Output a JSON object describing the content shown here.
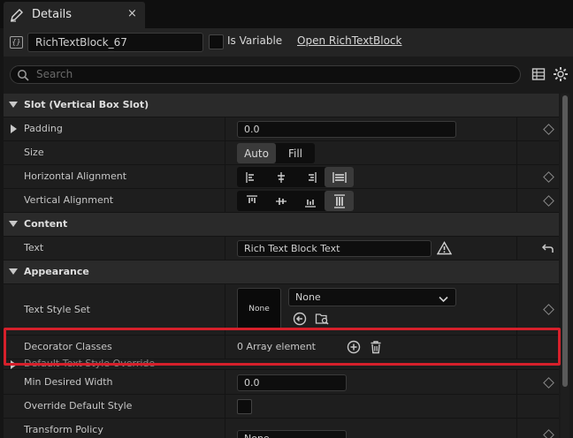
{
  "tab": {
    "title": "Details",
    "close": "×"
  },
  "header": {
    "widget_name": "RichTextBlock_67",
    "is_variable_label": "Is Variable",
    "open_link": "Open RichTextBlock"
  },
  "search": {
    "placeholder": "Search"
  },
  "sections": {
    "slot": "Slot (Vertical Box Slot)",
    "content": "Content",
    "appearance": "Appearance"
  },
  "props": {
    "padding": {
      "label": "Padding",
      "value": "0.0"
    },
    "size": {
      "label": "Size",
      "options": [
        "Auto",
        "Fill"
      ],
      "selected": "Auto"
    },
    "h_align": {
      "label": "Horizontal Alignment"
    },
    "v_align": {
      "label": "Vertical Alignment"
    },
    "text": {
      "label": "Text",
      "value": "Rich Text Block Text"
    },
    "text_style_set": {
      "label": "Text Style Set",
      "thumb": "None",
      "value": "None"
    },
    "decorator_classes": {
      "label": "Decorator Classes",
      "value": "0 Array element"
    },
    "default_text_style_override": {
      "label": "Default Text Style Override"
    },
    "min_desired_width": {
      "label": "Min Desired Width",
      "value": "0.0"
    },
    "override_default_style": {
      "label": "Override Default Style"
    },
    "partial": {
      "label": "Transform Policy",
      "value": "None"
    }
  },
  "colors": {
    "highlight": "#d6202b",
    "panel": "#1a1a1a"
  }
}
